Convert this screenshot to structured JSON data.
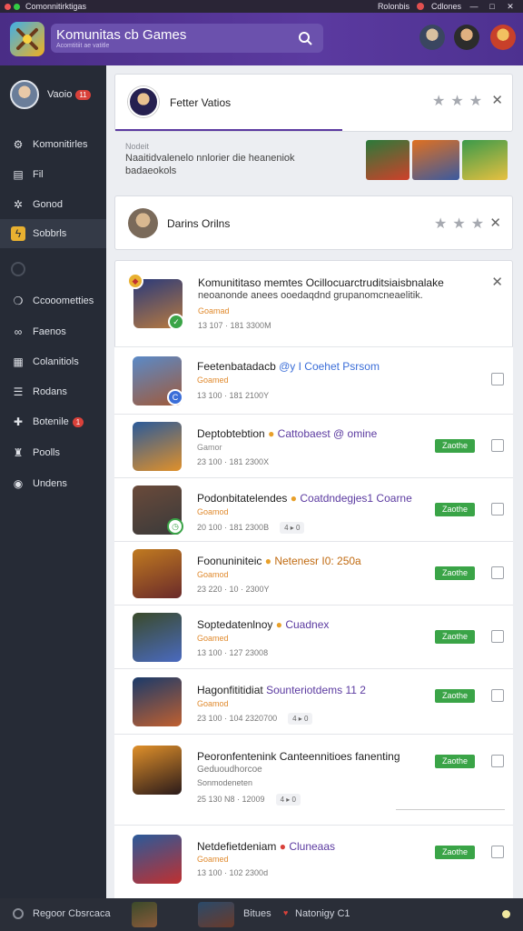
{
  "window": {
    "title": "Comonnitirktigas",
    "right_label_1": "Rolonbis",
    "right_label_2": "Cdlones",
    "btn_min": "—",
    "btn_max": "□",
    "btn_close": "✕"
  },
  "header": {
    "search_text": "Komunitas cb Games",
    "search_sub": "Acomtitiit ae vatitle",
    "colors": {
      "accent": "#5b3aa0",
      "header_bg": "#4f3394"
    }
  },
  "sidebar": {
    "profile_name": "Vaoio",
    "profile_badge": "11",
    "items": [
      {
        "label": "Komonitirles",
        "icon": "gear-icon"
      },
      {
        "label": "Fil",
        "icon": "chat-icon"
      },
      {
        "label": "Gonod",
        "icon": "settings-icon"
      },
      {
        "label": "Sobbrls",
        "icon": "lightning-icon",
        "active": true
      },
      {
        "label": "Ccooometties",
        "icon": "chat-bubble-icon"
      },
      {
        "label": "Faenos",
        "icon": "friends-icon"
      },
      {
        "label": "Colanitiols",
        "icon": "document-icon"
      },
      {
        "label": "Rodans",
        "icon": "list-icon"
      },
      {
        "label": "Botenile",
        "icon": "puzzle-icon",
        "badge": "1"
      },
      {
        "label": "Poolls",
        "icon": "users-icon"
      },
      {
        "label": "Undens",
        "icon": "circle-icon"
      }
    ]
  },
  "bottom": {
    "left_label": "Regoor Cbsrcaca",
    "preview_title": "Bitues",
    "preview_sub": "Natonigy C1"
  },
  "cards": {
    "top": {
      "name": "Fetter Vatios"
    },
    "notice": {
      "label": "Nodeit",
      "text_line1": "Naaitidvalenelo nnlorier die heaneniok",
      "text_line2": "badaeokols"
    },
    "second": {
      "name": "Darins Orilns"
    },
    "expanded": {
      "title_line1": "Komunititaso memtes Ocillocuarctruditsiaisbnalake",
      "title_line2": "neoanonde anees ooedaqdnd grupanomcneaelitik.",
      "sub": "Goamad",
      "meta": "13 107 · 181 3300M"
    }
  },
  "rows": [
    {
      "title": "Feetenbatadacb",
      "accent": "@y I Coehet Psrsom",
      "sub": "Goamed",
      "meta": "13 100 · 181 2100Y",
      "tag": "",
      "green": "",
      "overlay_color": "#3b6ed8"
    },
    {
      "title": "Deptobtebtion",
      "accent": "Cattobaest @ omine",
      "sub": "Gamor",
      "meta": "23 100 · 181 2300X",
      "tag": "",
      "green": "Zaothe",
      "overlay_color": "#e8a02a"
    },
    {
      "title": "Podonbitatelendes",
      "accent": "Coatdndegjes1 Coarne",
      "sub": "Goamod",
      "meta": "20 100 · 181 2300B",
      "tag": "4 ▸ 0",
      "green": "Zaothe",
      "overlay_color": "#3aa447"
    },
    {
      "title": "Foonuniniteic",
      "accent": "Netenesr I0: 250a",
      "sub": "Goamod",
      "meta": "23 220 · 10 · 2300Y",
      "tag": "",
      "green": "Zaothe",
      "overlay_color": "#e0a020"
    },
    {
      "title": "Soptedatenlnoy",
      "accent": "Cuadnex",
      "sub": "Goamed",
      "meta": "13 100 · 127 23008",
      "tag": "",
      "green": "Zaothe",
      "overlay_color": "#e8a02a"
    },
    {
      "title": "Hagonfititidiat",
      "accent": "Sounteriotdems 11 2",
      "sub": "Goamod",
      "meta": "23 100 · 104 2320700",
      "tag": "4 ▸ 0",
      "green": "Zaothe",
      "overlay_color": ""
    },
    {
      "title": "Peoronfentenink Canteennitioes",
      "accent": "fanenting",
      "sub": "Geduoudhorcoe",
      "sub2": "Sonmodeneten",
      "meta": "25 130 N8 · 12009",
      "tag": "4 ▸ 0",
      "green": "Zaothe",
      "overlay_color": ""
    },
    {
      "title": "Netdefietdeniam",
      "accent": "Cluneaas",
      "sub": "Goamed",
      "meta": "13 100 · 102 2300d",
      "tag": "",
      "green": "Zaothe",
      "overlay_color": "#d9413a"
    }
  ]
}
